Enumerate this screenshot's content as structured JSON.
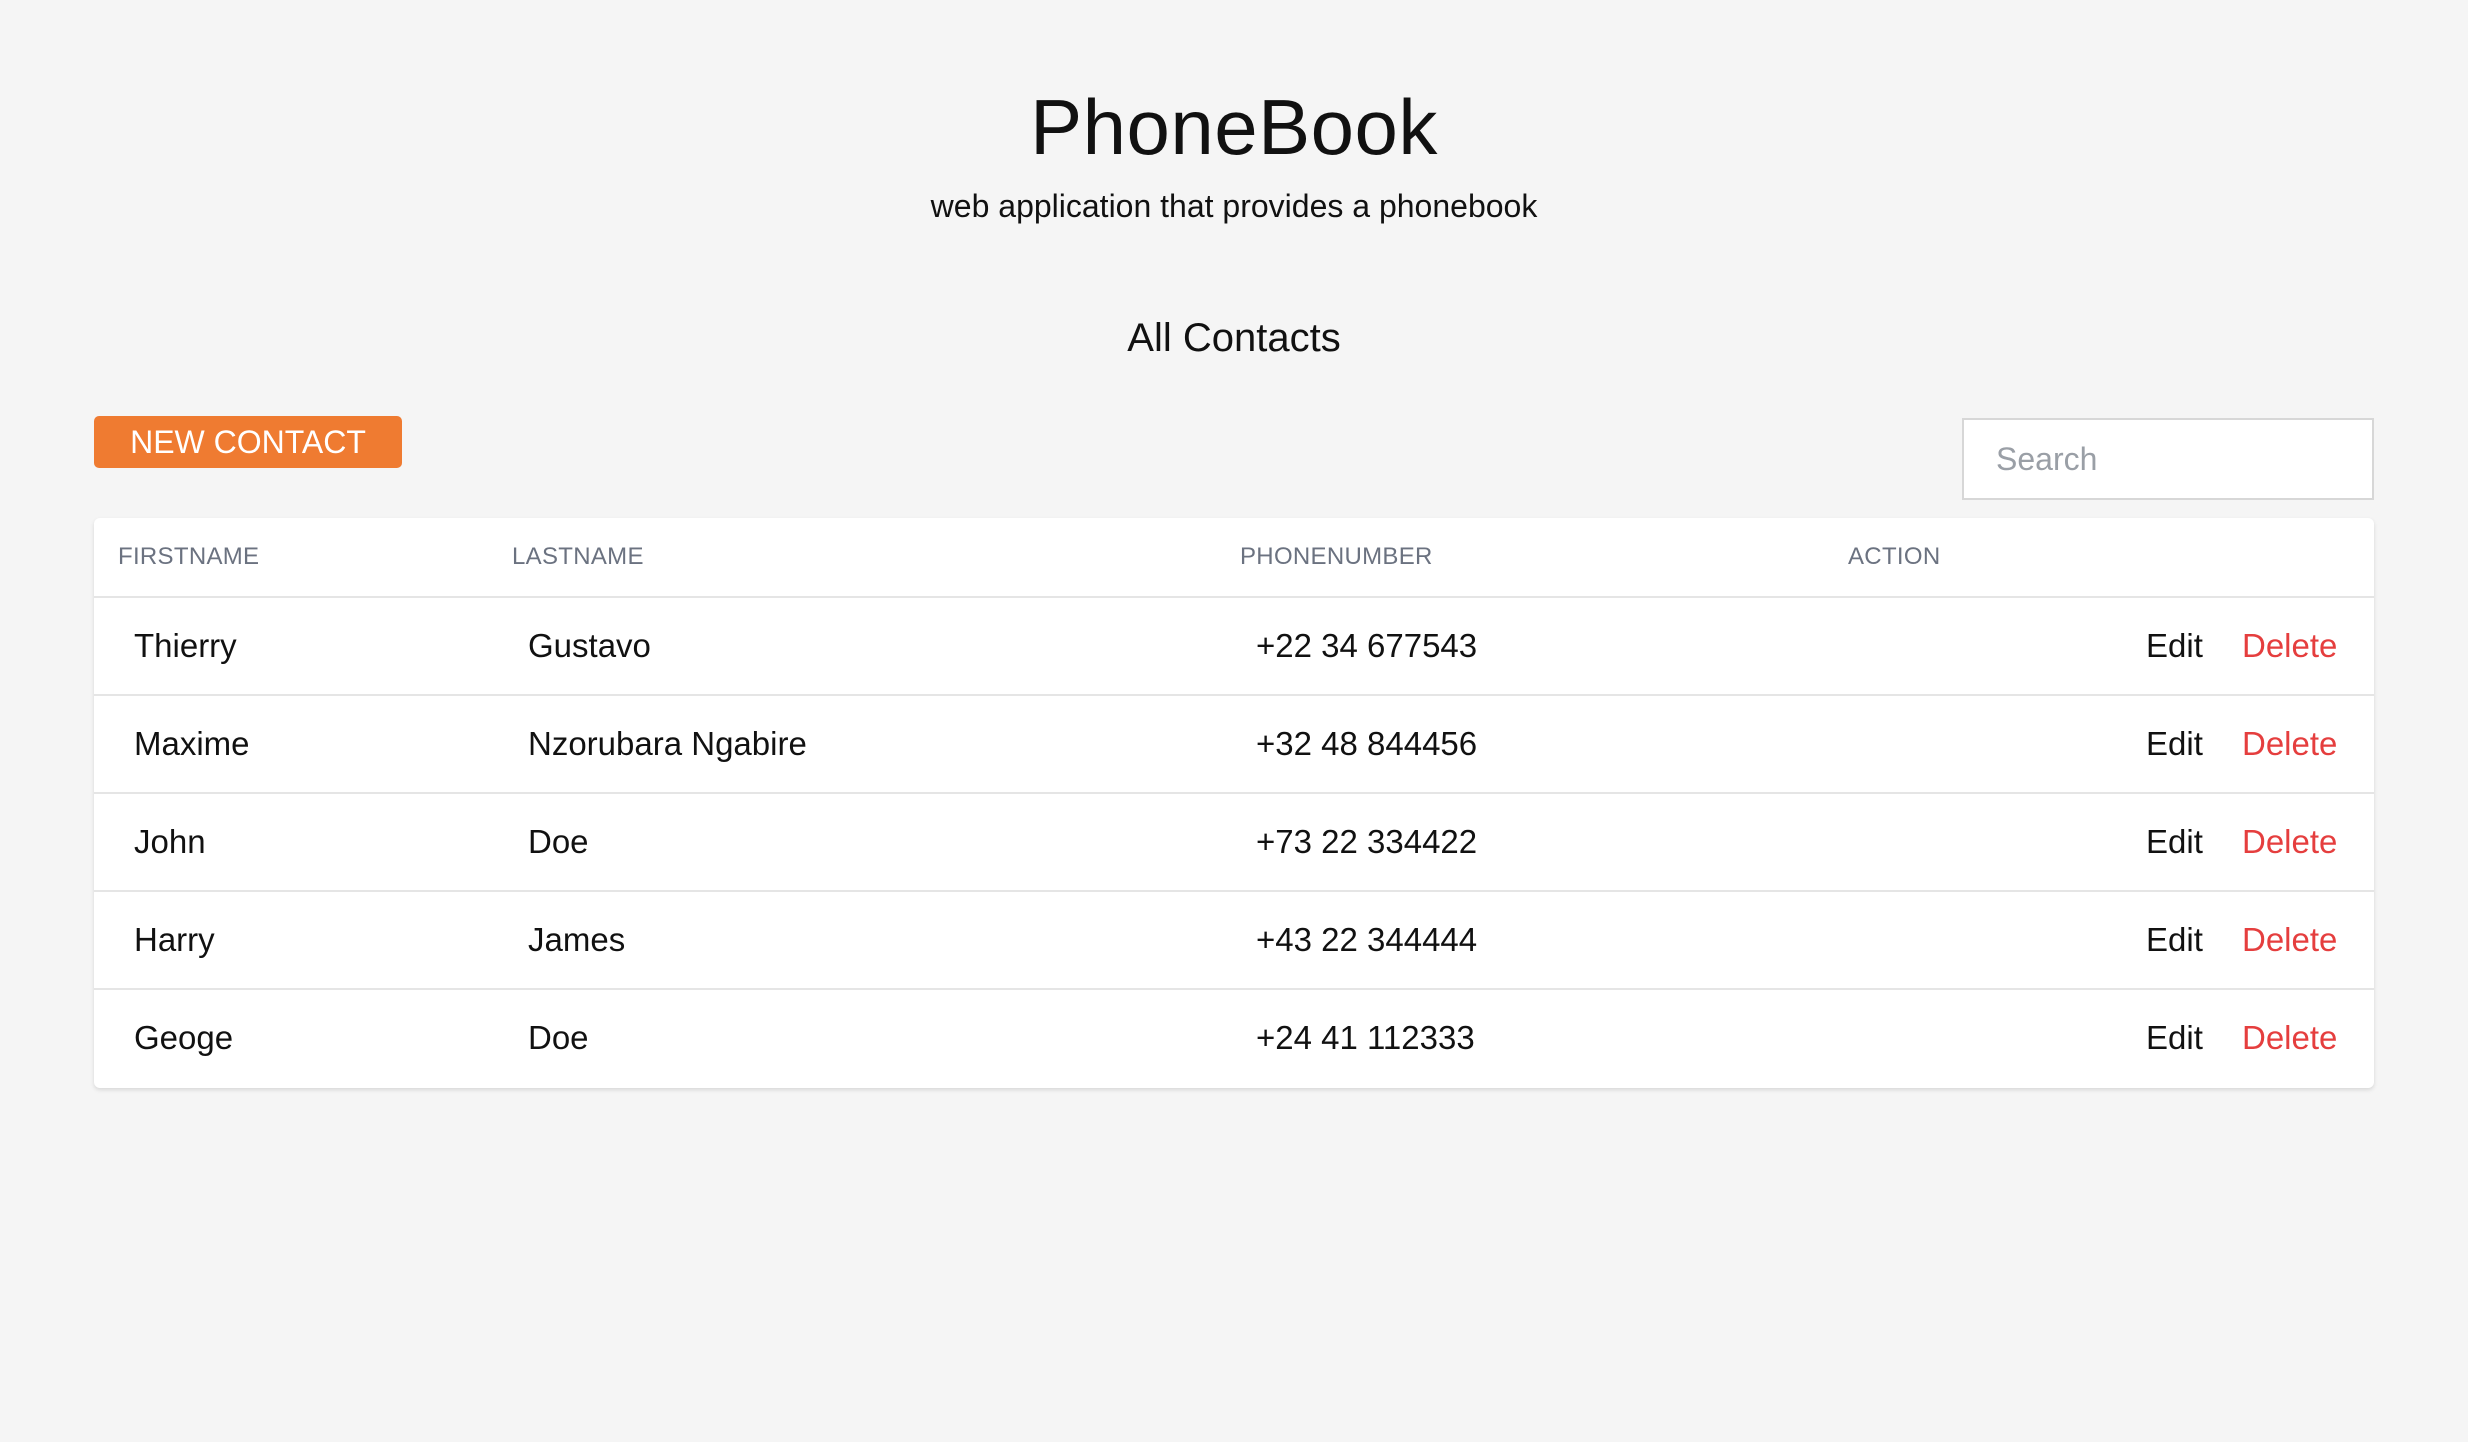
{
  "header": {
    "title": "PhoneBook",
    "subtitle": "web application that provides a phonebook"
  },
  "main": {
    "section_title": "All Contacts",
    "new_contact_label": "NEW CONTACT",
    "search_placeholder": "Search",
    "search_value": ""
  },
  "table": {
    "columns": [
      "FIRSTNAME",
      "LASTNAME",
      "PHONENUMBER",
      "ACTION"
    ],
    "rows": [
      {
        "firstname": "Thierry",
        "lastname": "Gustavo",
        "phone": "+22 34 677543",
        "edit": "Edit",
        "delete": "Delete"
      },
      {
        "firstname": "Maxime",
        "lastname": "Nzorubara Ngabire",
        "phone": "+32 48 844456",
        "edit": "Edit",
        "delete": "Delete"
      },
      {
        "firstname": "John",
        "lastname": "Doe",
        "phone": "+73 22 334422",
        "edit": "Edit",
        "delete": "Delete"
      },
      {
        "firstname": "Harry",
        "lastname": "James",
        "phone": "+43 22 344444",
        "edit": "Edit",
        "delete": "Delete"
      },
      {
        "firstname": "Geoge",
        "lastname": "Doe",
        "phone": "+24 41 112333",
        "edit": "Edit",
        "delete": "Delete"
      }
    ]
  },
  "colors": {
    "accent": "#ef7b31",
    "danger": "#e53e3e",
    "background": "#f5f5f5"
  }
}
